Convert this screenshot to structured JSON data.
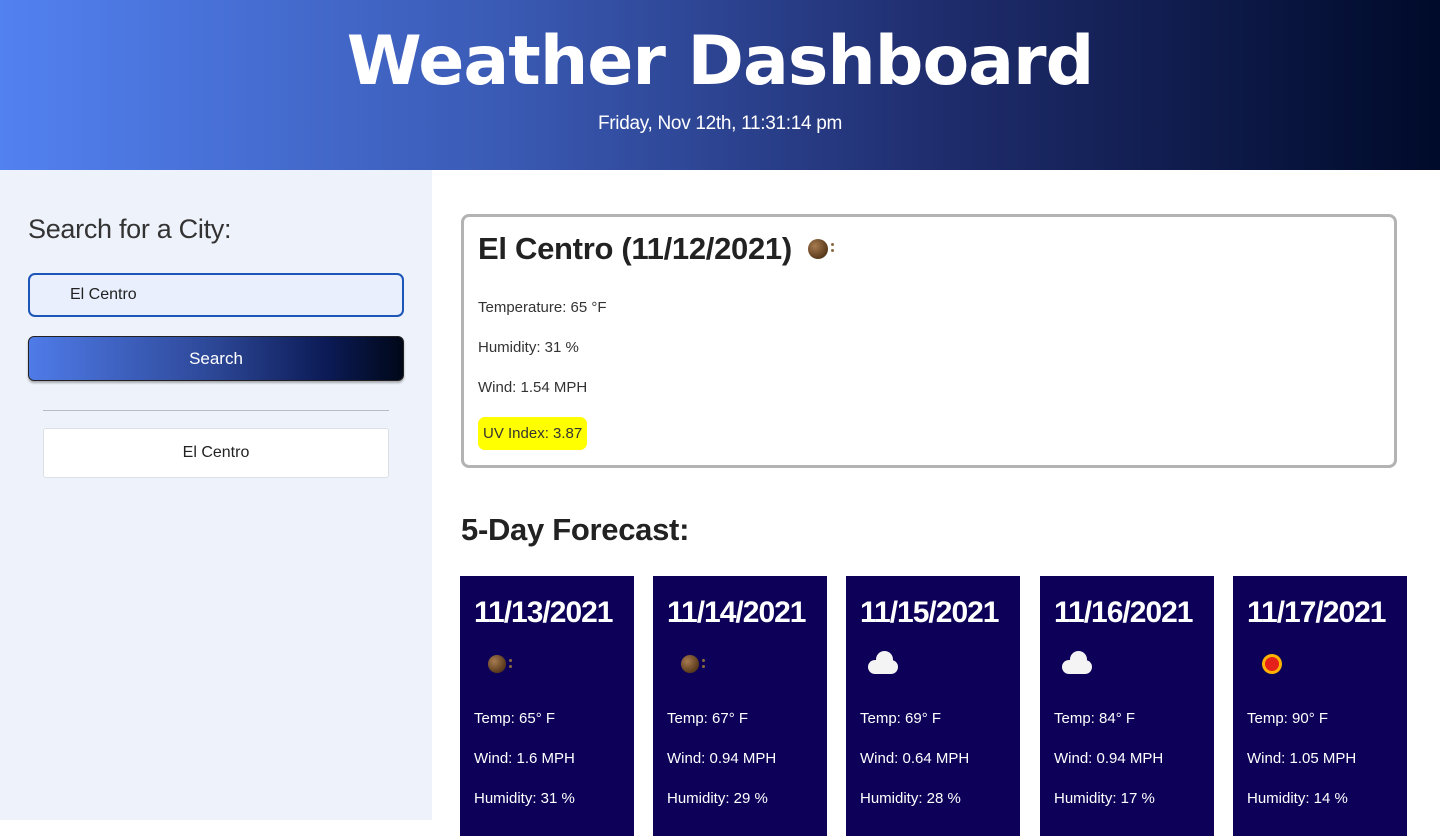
{
  "header": {
    "title": "Weather Dashboard",
    "datetime": "Friday, Nov 12th, 11:31:14 pm"
  },
  "sidebar": {
    "search_title": "Search for a City:",
    "search_value": "El Centro",
    "search_button": "Search",
    "history": [
      "El Centro"
    ]
  },
  "current": {
    "heading": "El Centro (11/12/2021)",
    "icon": "moon-icon",
    "temperature": "Temperature: 65 °F",
    "humidity": "Humidity: 31 %",
    "wind": "Wind: 1.54 MPH",
    "uv": "UV Index: 3.87",
    "uv_color": "#ffff00"
  },
  "forecast": {
    "title": "5-Day Forecast:",
    "days": [
      {
        "date": "11/13/2021",
        "icon": "moon-icon",
        "temp": "Temp: 65° F",
        "wind": "Wind: 1.6 MPH",
        "humidity": "Humidity: 31 %"
      },
      {
        "date": "11/14/2021",
        "icon": "moon-icon",
        "temp": "Temp: 67° F",
        "wind": "Wind: 0.94 MPH",
        "humidity": "Humidity: 29 %"
      },
      {
        "date": "11/15/2021",
        "icon": "cloud-icon",
        "temp": "Temp: 69° F",
        "wind": "Wind: 0.64 MPH",
        "humidity": "Humidity: 28 %"
      },
      {
        "date": "11/16/2021",
        "icon": "cloud-icon",
        "temp": "Temp: 84° F",
        "wind": "Wind: 0.94 MPH",
        "humidity": "Humidity: 17 %"
      },
      {
        "date": "11/17/2021",
        "icon": "sun-icon",
        "temp": "Temp: 90° F",
        "wind": "Wind: 1.05 MPH",
        "humidity": "Humidity: 14 %"
      }
    ],
    "card_color": "#0c0058"
  }
}
